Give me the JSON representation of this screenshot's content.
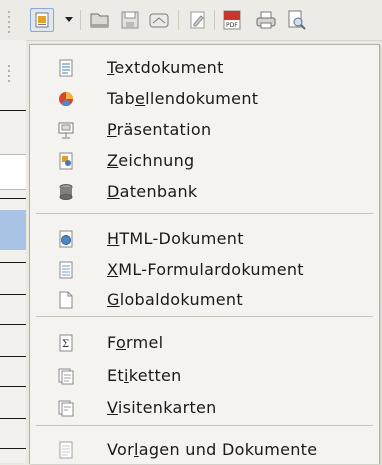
{
  "toolbar": {
    "buttons": [
      {
        "name": "new-document-icon"
      },
      {
        "name": "dropdown-arrow-icon"
      },
      {
        "name": "open-folder-icon"
      },
      {
        "name": "save-icon"
      },
      {
        "name": "email-icon"
      },
      {
        "name": "edit-file-icon"
      },
      {
        "name": "export-pdf-icon"
      },
      {
        "name": "print-icon"
      },
      {
        "name": "print-preview-icon"
      }
    ]
  },
  "menu": {
    "groups": [
      {
        "items": [
          {
            "pre": "",
            "mn": "T",
            "post": "extdokument",
            "icon": "text-document-icon"
          },
          {
            "pre": "Tab",
            "mn": "e",
            "post": "llendokument",
            "icon": "spreadsheet-icon"
          },
          {
            "pre": "",
            "mn": "P",
            "post": "räsentation",
            "icon": "presentation-icon"
          },
          {
            "pre": "",
            "mn": "Z",
            "post": "eichnung",
            "icon": "drawing-icon"
          },
          {
            "pre": "",
            "mn": "D",
            "post": "atenbank",
            "icon": "database-icon"
          }
        ]
      },
      {
        "items": [
          {
            "pre": "",
            "mn": "H",
            "post": "TML-Dokument",
            "icon": "html-document-icon"
          },
          {
            "pre": "",
            "mn": "X",
            "post": "ML-Formulardokument",
            "icon": "xml-form-icon"
          },
          {
            "pre": "",
            "mn": "G",
            "post": "lobaldokument",
            "icon": "global-document-icon"
          }
        ]
      },
      {
        "items": [
          {
            "pre": "F",
            "mn": "o",
            "post": "rmel",
            "icon": "formula-icon"
          },
          {
            "pre": "Et",
            "mn": "i",
            "post": "ketten",
            "icon": "labels-icon"
          },
          {
            "pre": "",
            "mn": "V",
            "post": "isitenkarten",
            "icon": "business-cards-icon"
          }
        ]
      },
      {
        "items": [
          {
            "pre": "Vor",
            "mn": "l",
            "post": "agen und Dokumente",
            "icon": "templates-icon"
          }
        ]
      }
    ]
  }
}
